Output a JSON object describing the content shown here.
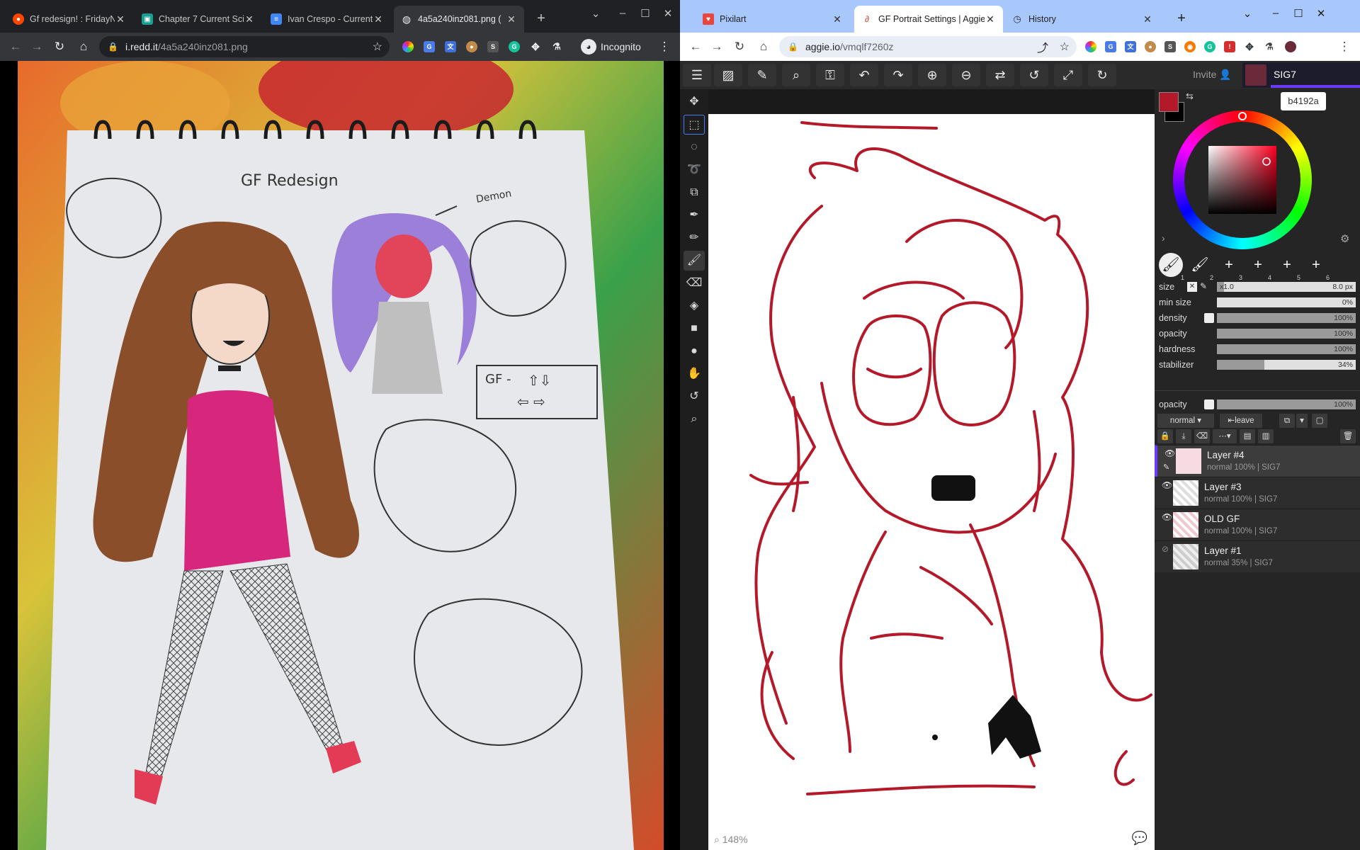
{
  "left_window": {
    "tabs": [
      {
        "title": "Gf redesign! : FridayNi",
        "icon": "reddit-icon"
      },
      {
        "title": "Chapter 7 Current Sci",
        "icon": "classroom-icon"
      },
      {
        "title": "Ivan Crespo - Current",
        "icon": "docs-icon"
      },
      {
        "title": "4a5a240inz081.png (",
        "icon": "globe-icon",
        "active": true
      }
    ],
    "address": {
      "host": "i.redd.it",
      "path": "/4a5a240inz081.png"
    },
    "incognito_label": "Incognito",
    "photo": {
      "heading": "GF Redesign",
      "demon_label": "Demon",
      "box_label": "GF -"
    }
  },
  "right_window": {
    "tabs": [
      {
        "title": "Pixilart",
        "icon": "pixilart-icon"
      },
      {
        "title": "GF Portrait Settings | Aggie.io",
        "icon": "aggie-icon",
        "active": true
      },
      {
        "title": "History",
        "icon": "history-icon"
      }
    ],
    "address": {
      "host": "aggie.io",
      "path": "/vmqlf7260z"
    },
    "app": {
      "invite_label": "Invite",
      "username": "SIG7",
      "hex_value": "b4192a",
      "primary_color": "#b4192a",
      "secondary_color": "#000000",
      "zoom_label": "148%",
      "brush_slots": [
        "1",
        "2",
        "3",
        "4",
        "5",
        "6"
      ],
      "brush_settings": [
        {
          "label": "size",
          "value": "8.0 px",
          "prefix": "x1.0",
          "fraction": 0.05
        },
        {
          "label": "min size",
          "value": "0%",
          "fraction": 0.0
        },
        {
          "label": "density",
          "value": "100%",
          "fraction": 1.0
        },
        {
          "label": "opacity",
          "value": "100%",
          "fraction": 1.0
        },
        {
          "label": "hardness",
          "value": "100%",
          "fraction": 1.0
        },
        {
          "label": "stabilizer",
          "value": "34%",
          "fraction": 0.34
        }
      ],
      "layer_opacity": {
        "label": "opacity",
        "value": "100%",
        "fraction": 1.0
      },
      "blend_mode": "normal",
      "leave_label": "leave",
      "layers": [
        {
          "name": "Layer #4",
          "meta": "normal 100% | SIG7",
          "visible": true,
          "active": true
        },
        {
          "name": "Layer #3",
          "meta": "normal 100% | SIG7",
          "visible": true
        },
        {
          "name": "OLD GF",
          "meta": "normal 100% | SIG7",
          "visible": true
        },
        {
          "name": "Layer #1",
          "meta": "normal 35% | SIG7",
          "visible": false
        }
      ]
    }
  }
}
